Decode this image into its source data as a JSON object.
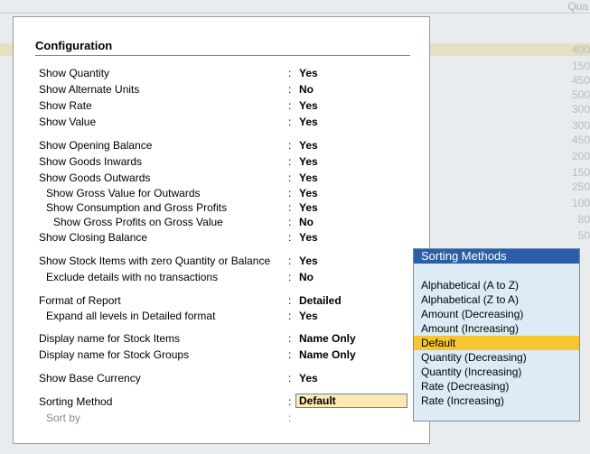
{
  "background": {
    "column_header": "Qua",
    "numbers": [
      "400",
      "150",
      "450",
      "500",
      "300",
      "300",
      "450",
      "200",
      "150",
      "250",
      "100",
      "80",
      "50"
    ]
  },
  "config": {
    "title": "Configuration",
    "rows": [
      {
        "label": "Show Quantity",
        "value": "Yes"
      },
      {
        "label": "Show Alternate Units",
        "value": "No"
      },
      {
        "label": "Show Rate",
        "value": "Yes"
      },
      {
        "label": "Show Value",
        "value": "Yes"
      },
      {
        "label": "Show Opening Balance",
        "value": "Yes"
      },
      {
        "label": "Show Goods Inwards",
        "value": "Yes"
      },
      {
        "label": "Show Goods Outwards",
        "value": "Yes"
      },
      {
        "label": "Show Gross Value for Outwards",
        "value": "Yes"
      },
      {
        "label": "Show Consumption and Gross Profits",
        "value": "Yes"
      },
      {
        "label": "Show Gross Profits on Gross Value",
        "value": "No"
      },
      {
        "label": "Show Closing Balance",
        "value": "Yes"
      },
      {
        "label": "Show Stock Items with zero Quantity or Balance",
        "value": "Yes"
      },
      {
        "label": "Exclude details with no transactions",
        "value": "No"
      },
      {
        "label": "Format of Report",
        "value": "Detailed"
      },
      {
        "label": "Expand all levels in Detailed format",
        "value": "Yes"
      },
      {
        "label": "Display name for Stock Items",
        "value": "Name Only"
      },
      {
        "label": "Display name for Stock Groups",
        "value": "Name Only"
      },
      {
        "label": "Show Base Currency",
        "value": "Yes"
      },
      {
        "label": "Sorting Method",
        "value": "Default"
      },
      {
        "label": "Sort by",
        "value": ""
      }
    ],
    "colon": ":"
  },
  "sorting_popup": {
    "title": "Sorting Methods",
    "items": [
      "Alphabetical (A to Z)",
      "Alphabetical (Z to A)",
      "Amount (Decreasing)",
      "Amount (Increasing)",
      "Default",
      "Quantity (Decreasing)",
      "Quantity (Increasing)",
      "Rate (Decreasing)",
      "Rate (Increasing)"
    ],
    "selected": "Default",
    "selected_color": "#f7c531",
    "title_color": "#2a5ea8"
  }
}
